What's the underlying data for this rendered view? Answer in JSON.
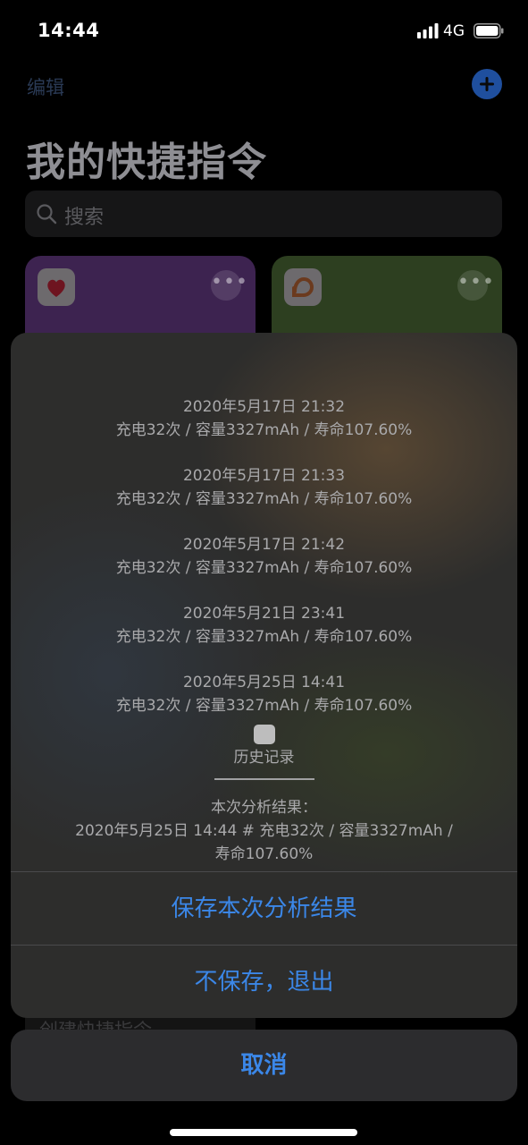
{
  "status_bar": {
    "time": "14:44",
    "network": "4G",
    "icons": [
      "signal-icon",
      "battery-icon"
    ]
  },
  "background": {
    "edit_label": "编辑",
    "title": "我的快捷指令",
    "search_placeholder": "搜索",
    "create_label": "创建快捷指令",
    "cards": [
      {
        "icon": "heart-icon",
        "color": "#3d2350"
      },
      {
        "icon": "didi-icon",
        "color": "#2d3f20"
      }
    ]
  },
  "sheet": {
    "records": [
      {
        "date": "2020年5月17日 21:32",
        "info": "充电32次 / 容量3327mAh / 寿命107.60%"
      },
      {
        "date": "2020年5月17日 21:33",
        "info": "充电32次 / 容量3327mAh / 寿命107.60%"
      },
      {
        "date": "2020年5月17日 21:42",
        "info": "充电32次 / 容量3327mAh / 寿命107.60%"
      },
      {
        "date": "2020年5月21日 23:41",
        "info": "充电32次 / 容量3327mAh / 寿命107.60%"
      },
      {
        "date": "2020年5月25日 14:41",
        "info": "充电32次 / 容量3327mAh / 寿命107.60%"
      }
    ],
    "history_label": "历史记录",
    "result_title": "本次分析结果：",
    "result_line1": "2020年5月25日 14:44 # 充电32次 / 容量3327mAh /",
    "result_line2": "寿命107.60%",
    "save_button": "保存本次分析结果",
    "nosave_button": "不保存，退出"
  },
  "cancel_button": "取消",
  "colors": {
    "accent": "#3b87e8",
    "sheet_bg": "#2d2d2c",
    "cancel_bg": "#2c2c2e"
  }
}
